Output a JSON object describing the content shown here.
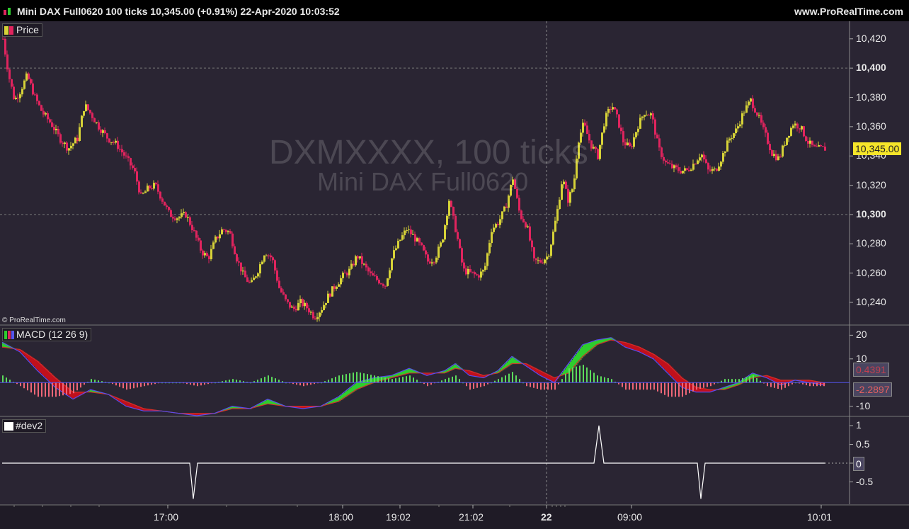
{
  "header": {
    "title": "Mini DAX Full0620 100 ticks 10,345.00 (+0.91%) 22-Apr-2020 10:03:52",
    "site": "www.ProRealTime.com"
  },
  "watermark": {
    "line1": "DXMXXXX, 100 ticks",
    "line2": "Mini DAX Full0620"
  },
  "copyright": "© ProRealTime.com",
  "panels": {
    "price": {
      "label": "Price"
    },
    "macd": {
      "label": "MACD (12 26 9)"
    },
    "dev": {
      "label": "#dev2"
    }
  },
  "colors": {
    "background": "#2a2533",
    "bull_candle": "#d6d238",
    "bear_candle": "#e0245e",
    "macd_green": "#2ecc2e",
    "macd_red": "#c0101c",
    "hist_pos": "#5cdc5c",
    "hist_neg": "#ee6677",
    "price_badge": "#f5e52a"
  },
  "chart_data": [
    {
      "type": "candlestick",
      "title": "Price",
      "ylim": [
        10225,
        10432
      ],
      "y_ticks": [
        "10,420",
        "10,400",
        "10,380",
        "10,360",
        "10,340",
        "10,320",
        "10,300",
        "10,280",
        "10,260",
        "10,240"
      ],
      "bold_ticks": [
        "10,400",
        "10,300"
      ],
      "last_price": "10,345.00",
      "x_ticks": [
        "17:00",
        "18:00",
        "19:02",
        "21:02",
        "22",
        "09:00",
        "10:01"
      ],
      "bold_x_ticks": [
        "22"
      ],
      "close_path": [
        [
          0,
          10420
        ],
        [
          8,
          10395
        ],
        [
          16,
          10378
        ],
        [
          24,
          10384
        ],
        [
          34,
          10395
        ],
        [
          45,
          10380
        ],
        [
          55,
          10370
        ],
        [
          68,
          10362
        ],
        [
          80,
          10352
        ],
        [
          92,
          10345
        ],
        [
          105,
          10352
        ],
        [
          115,
          10375
        ],
        [
          125,
          10368
        ],
        [
          135,
          10360
        ],
        [
          148,
          10352
        ],
        [
          160,
          10348
        ],
        [
          172,
          10340
        ],
        [
          185,
          10330
        ],
        [
          195,
          10312
        ],
        [
          205,
          10318
        ],
        [
          215,
          10320
        ],
        [
          225,
          10310
        ],
        [
          235,
          10300
        ],
        [
          247,
          10298
        ],
        [
          258,
          10300
        ],
        [
          268,
          10290
        ],
        [
          280,
          10275
        ],
        [
          290,
          10270
        ],
        [
          300,
          10283
        ],
        [
          310,
          10290
        ],
        [
          320,
          10288
        ],
        [
          330,
          10270
        ],
        [
          340,
          10258
        ],
        [
          350,
          10252
        ],
        [
          360,
          10262
        ],
        [
          370,
          10275
        ],
        [
          380,
          10270
        ],
        [
          390,
          10250
        ],
        [
          400,
          10240
        ],
        [
          410,
          10235
        ],
        [
          420,
          10240
        ],
        [
          430,
          10236
        ],
        [
          440,
          10230
        ],
        [
          450,
          10236
        ],
        [
          460,
          10245
        ],
        [
          470,
          10252
        ],
        [
          480,
          10258
        ],
        [
          490,
          10262
        ],
        [
          500,
          10272
        ],
        [
          510,
          10265
        ],
        [
          520,
          10258
        ],
        [
          530,
          10255
        ],
        [
          540,
          10252
        ],
        [
          550,
          10272
        ],
        [
          560,
          10282
        ],
        [
          570,
          10290
        ],
        [
          580,
          10285
        ],
        [
          590,
          10278
        ],
        [
          600,
          10268
        ],
        [
          610,
          10270
        ],
        [
          620,
          10282
        ],
        [
          630,
          10310
        ],
        [
          640,
          10288
        ],
        [
          650,
          10262
        ],
        [
          660,
          10260
        ],
        [
          670,
          10258
        ],
        [
          680,
          10262
        ],
        [
          690,
          10290
        ],
        [
          700,
          10295
        ],
        [
          710,
          10305
        ],
        [
          720,
          10325
        ],
        [
          730,
          10300
        ],
        [
          740,
          10292
        ],
        [
          750,
          10268
        ],
        [
          760,
          10268
        ],
        [
          770,
          10272
        ],
        [
          776,
          10285
        ],
        [
          782,
          10300
        ],
        [
          790,
          10325
        ],
        [
          798,
          10310
        ],
        [
          806,
          10320
        ],
        [
          812,
          10350
        ],
        [
          820,
          10362
        ],
        [
          830,
          10348
        ],
        [
          840,
          10340
        ],
        [
          850,
          10365
        ],
        [
          860,
          10375
        ],
        [
          868,
          10365
        ],
        [
          876,
          10350
        ],
        [
          886,
          10345
        ],
        [
          896,
          10360
        ],
        [
          906,
          10370
        ],
        [
          916,
          10368
        ],
        [
          926,
          10345
        ],
        [
          936,
          10335
        ],
        [
          946,
          10332
        ],
        [
          956,
          10330
        ],
        [
          966,
          10330
        ],
        [
          976,
          10335
        ],
        [
          986,
          10342
        ],
        [
          996,
          10330
        ],
        [
          1006,
          10330
        ],
        [
          1016,
          10340
        ],
        [
          1026,
          10352
        ],
        [
          1036,
          10358
        ],
        [
          1046,
          10370
        ],
        [
          1056,
          10378
        ],
        [
          1066,
          10368
        ],
        [
          1076,
          10355
        ],
        [
          1086,
          10342
        ],
        [
          1096,
          10338
        ],
        [
          1106,
          10352
        ],
        [
          1116,
          10362
        ],
        [
          1126,
          10360
        ],
        [
          1136,
          10350
        ],
        [
          1146,
          10345
        ],
        [
          1156,
          10345
        ],
        [
          1162,
          10345
        ]
      ]
    },
    {
      "type": "area",
      "title": "MACD (12 26 9)",
      "ylim": [
        -14,
        24
      ],
      "y_ticks": [
        "20",
        "10",
        "-10"
      ],
      "value_labels": [
        "0.4391",
        "-2.2897"
      ],
      "macd_path": [
        [
          0,
          17
        ],
        [
          25,
          13
        ],
        [
          50,
          5
        ],
        [
          75,
          -2
        ],
        [
          100,
          -7
        ],
        [
          125,
          -3
        ],
        [
          150,
          -5
        ],
        [
          175,
          -10
        ],
        [
          200,
          -12
        ],
        [
          225,
          -12
        ],
        [
          250,
          -13
        ],
        [
          275,
          -14
        ],
        [
          300,
          -13
        ],
        [
          325,
          -10
        ],
        [
          350,
          -11
        ],
        [
          375,
          -7
        ],
        [
          400,
          -10
        ],
        [
          425,
          -11
        ],
        [
          450,
          -10
        ],
        [
          475,
          -6
        ],
        [
          500,
          0
        ],
        [
          525,
          2
        ],
        [
          550,
          3
        ],
        [
          575,
          6
        ],
        [
          600,
          3
        ],
        [
          625,
          5
        ],
        [
          640,
          8
        ],
        [
          660,
          3
        ],
        [
          680,
          2
        ],
        [
          700,
          5
        ],
        [
          720,
          11
        ],
        [
          740,
          7
        ],
        [
          760,
          3
        ],
        [
          780,
          0
        ],
        [
          800,
          8
        ],
        [
          820,
          16
        ],
        [
          840,
          18
        ],
        [
          860,
          19
        ],
        [
          880,
          15
        ],
        [
          900,
          13
        ],
        [
          920,
          10
        ],
        [
          940,
          4
        ],
        [
          960,
          -2
        ],
        [
          980,
          -4
        ],
        [
          1000,
          -4
        ],
        [
          1020,
          -2
        ],
        [
          1040,
          0
        ],
        [
          1060,
          4
        ],
        [
          1080,
          2
        ],
        [
          1100,
          -1
        ],
        [
          1120,
          1
        ],
        [
          1140,
          0
        ],
        [
          1160,
          -1
        ]
      ],
      "signal_path": [
        [
          0,
          15
        ],
        [
          25,
          14
        ],
        [
          50,
          9
        ],
        [
          75,
          2
        ],
        [
          100,
          -4
        ],
        [
          125,
          -4
        ],
        [
          150,
          -5
        ],
        [
          175,
          -8
        ],
        [
          200,
          -11
        ],
        [
          225,
          -12
        ],
        [
          250,
          -13
        ],
        [
          275,
          -13
        ],
        [
          300,
          -13
        ],
        [
          325,
          -11
        ],
        [
          350,
          -11
        ],
        [
          375,
          -9
        ],
        [
          400,
          -10
        ],
        [
          425,
          -10
        ],
        [
          450,
          -10
        ],
        [
          475,
          -8
        ],
        [
          500,
          -3
        ],
        [
          525,
          0
        ],
        [
          550,
          2
        ],
        [
          575,
          4
        ],
        [
          600,
          4
        ],
        [
          625,
          4
        ],
        [
          640,
          6
        ],
        [
          660,
          5
        ],
        [
          680,
          3
        ],
        [
          700,
          4
        ],
        [
          720,
          8
        ],
        [
          740,
          8
        ],
        [
          760,
          5
        ],
        [
          780,
          2
        ],
        [
          800,
          4
        ],
        [
          820,
          11
        ],
        [
          840,
          16
        ],
        [
          860,
          18
        ],
        [
          880,
          17
        ],
        [
          900,
          15
        ],
        [
          920,
          12
        ],
        [
          940,
          8
        ],
        [
          960,
          2
        ],
        [
          980,
          -2
        ],
        [
          1000,
          -3
        ],
        [
          1020,
          -3
        ],
        [
          1040,
          -1
        ],
        [
          1060,
          2
        ],
        [
          1080,
          3
        ],
        [
          1100,
          1
        ],
        [
          1120,
          1
        ],
        [
          1140,
          1
        ],
        [
          1160,
          0
        ]
      ]
    },
    {
      "type": "line",
      "title": "#dev2",
      "ylim": [
        -1,
        1
      ],
      "y_ticks": [
        "1",
        "0.5",
        "0",
        "-0.5"
      ],
      "value_label": "0",
      "path": [
        [
          0,
          0
        ],
        [
          265,
          0
        ],
        [
          270,
          -0.95
        ],
        [
          276,
          0
        ],
        [
          836,
          0
        ],
        [
          843,
          1
        ],
        [
          850,
          0
        ],
        [
          982,
          0
        ],
        [
          987,
          -0.95
        ],
        [
          993,
          0
        ],
        [
          1162,
          0
        ]
      ]
    }
  ]
}
